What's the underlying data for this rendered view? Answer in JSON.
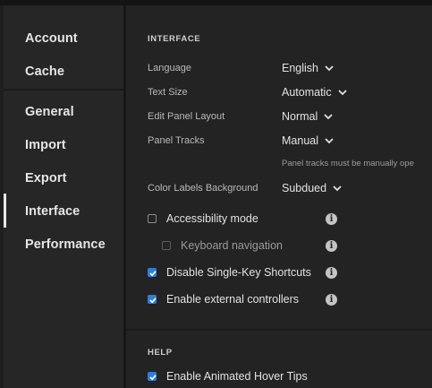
{
  "sidebar": {
    "items": [
      {
        "label": "Account"
      },
      {
        "label": "Cache"
      },
      {
        "label": "General"
      },
      {
        "label": "Import"
      },
      {
        "label": "Export"
      },
      {
        "label": "Interface"
      },
      {
        "label": "Performance"
      }
    ],
    "active": "Interface"
  },
  "interface": {
    "title": "INTERFACE",
    "language": {
      "label": "Language",
      "value": "English"
    },
    "text_size": {
      "label": "Text Size",
      "value": "Automatic"
    },
    "edit_panel_layout": {
      "label": "Edit Panel Layout",
      "value": "Normal"
    },
    "panel_tracks": {
      "label": "Panel Tracks",
      "value": "Manual",
      "hint": "Panel tracks must be manually ope"
    },
    "color_labels_background": {
      "label": "Color Labels Background",
      "value": "Subdued"
    },
    "accessibility_mode": {
      "label": "Accessibility mode",
      "checked": false
    },
    "keyboard_navigation": {
      "label": "Keyboard navigation",
      "checked": false
    },
    "disable_single_key_shortcuts": {
      "label": "Disable Single-Key Shortcuts",
      "checked": true
    },
    "enable_external_controllers": {
      "label": "Enable external controllers",
      "checked": true
    }
  },
  "help": {
    "title": "HELP",
    "enable_animated_hover_tips": {
      "label": "Enable Animated Hover Tips",
      "checked": true
    }
  },
  "icons": {
    "info": "info-icon",
    "chevron": "chevron-down-icon",
    "check": "checkmark-icon"
  },
  "colors": {
    "accent": "#2f7fd3",
    "background": "#232323",
    "sidebar": "#262626"
  }
}
